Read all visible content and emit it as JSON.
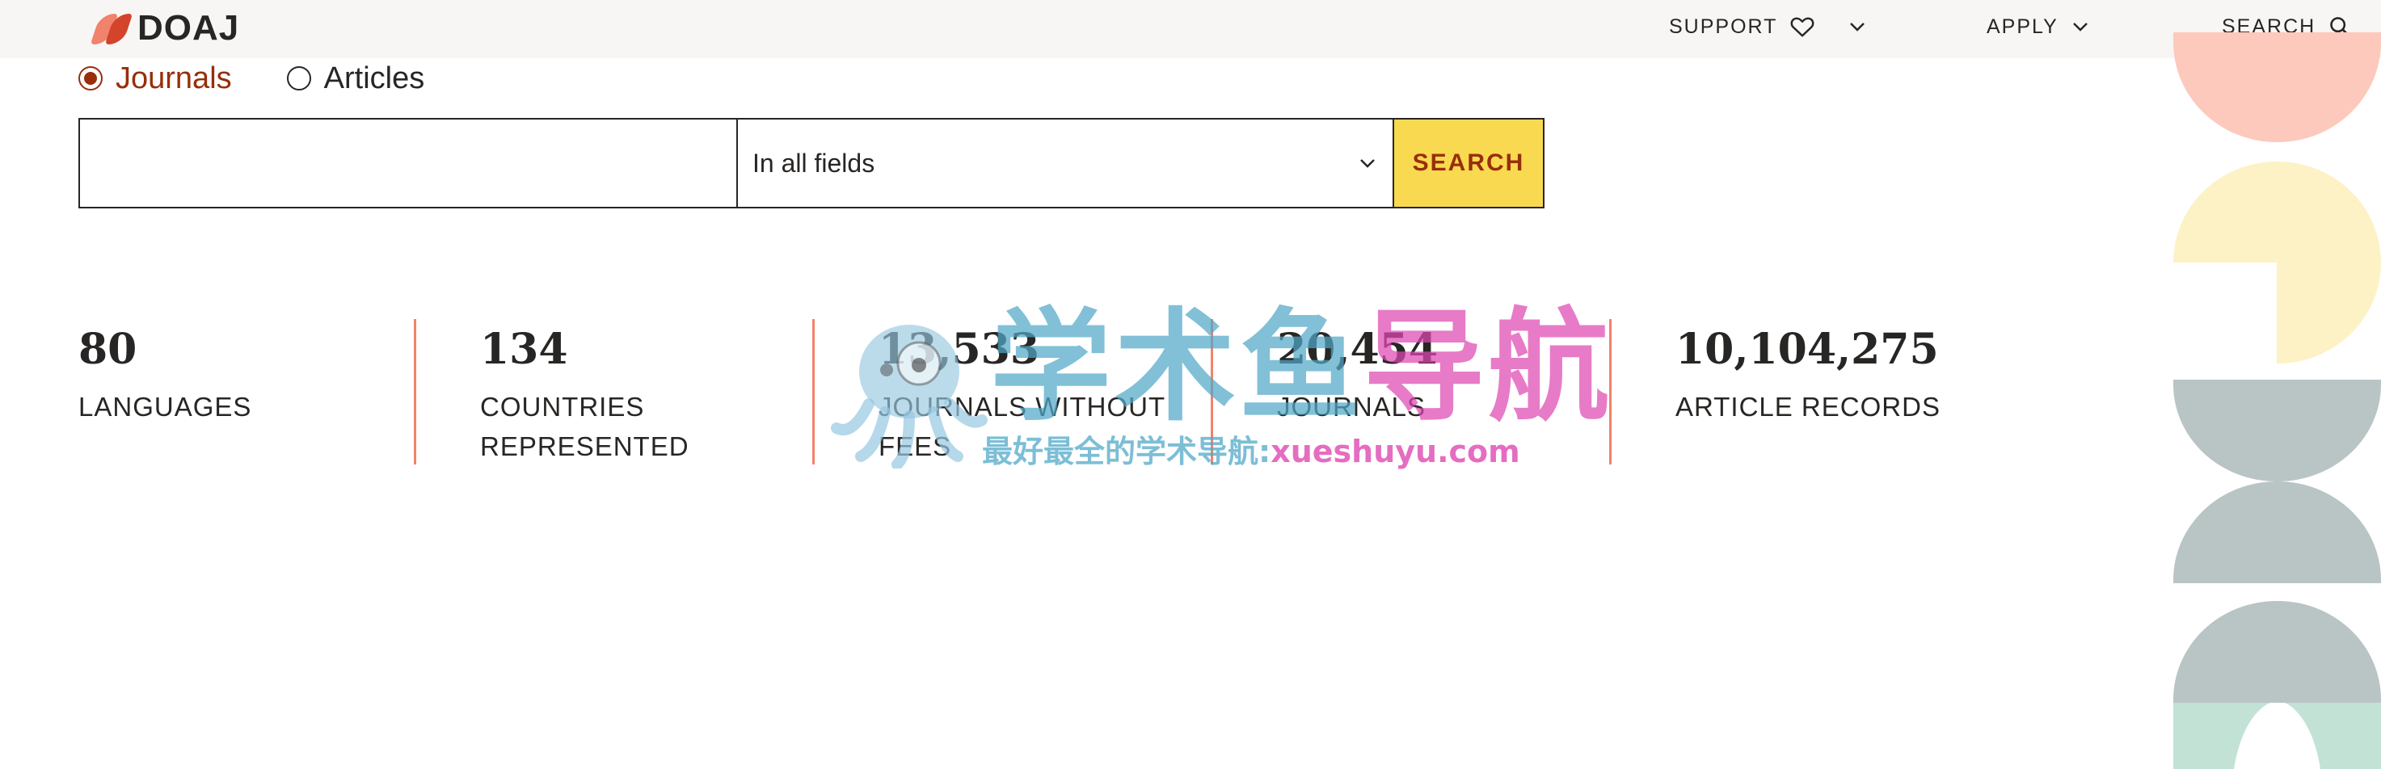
{
  "header": {
    "logo_text": "DOAJ",
    "nav": {
      "support": "SUPPORT",
      "apply": "APPLY",
      "search": "SEARCH"
    }
  },
  "search": {
    "radios": [
      {
        "label": "Journals",
        "checked": true
      },
      {
        "label": "Articles",
        "checked": false
      }
    ],
    "input_value": "",
    "input_placeholder": "",
    "field_selected": "In all fields",
    "button_label": "SEARCH"
  },
  "stats": [
    {
      "value": "80",
      "label": "LANGUAGES"
    },
    {
      "value": "134",
      "label": "COUNTRIES REPRESENTED"
    },
    {
      "value": "13,533",
      "label": "JOURNALS WITHOUT FEES"
    },
    {
      "value": "20,454",
      "label": "JOURNALS"
    },
    {
      "value": "10,104,275",
      "label": "ARTICLE RECORDS"
    }
  ],
  "watermark": {
    "title_blue": "学术鱼",
    "title_pink": "导航",
    "subtitle_blue": "最好最全的学术导航:",
    "subtitle_pink": "xueshuyu.com"
  },
  "colors": {
    "accent": "#982e0a",
    "search_button": "#f9d950",
    "divider": "#f1826b",
    "deco_pink": "#fdc9bd",
    "deco_yellow": "#fdf2c6",
    "deco_grey": "#b9c5c4",
    "deco_mint": "#c3e2d6"
  }
}
